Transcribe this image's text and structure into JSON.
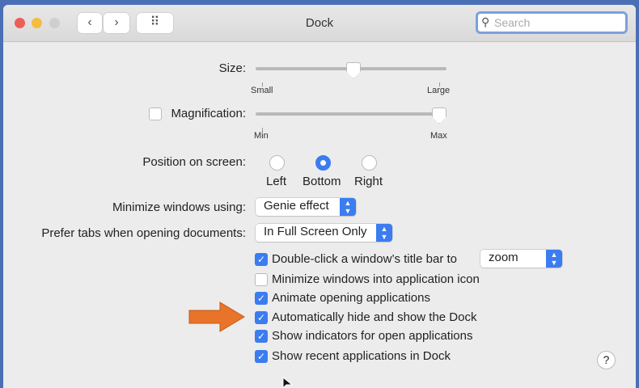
{
  "window": {
    "title": "Dock",
    "search_placeholder": "Search"
  },
  "toolbar": {
    "back": "‹",
    "forward": "›",
    "grid": "⠿"
  },
  "size": {
    "label": "Size:",
    "min": "Small",
    "max": "Large",
    "value_fraction": 0.5
  },
  "magnification": {
    "label": "Magnification:",
    "checked": false,
    "min": "Min",
    "max": "Max",
    "value_fraction": 1.0
  },
  "position": {
    "label": "Position on screen:",
    "options": [
      "Left",
      "Bottom",
      "Right"
    ],
    "selected": "Bottom"
  },
  "minimize": {
    "label": "Minimize windows using:",
    "value": "Genie effect"
  },
  "prefer_tabs": {
    "label": "Prefer tabs when opening documents:",
    "value": "In Full Screen Only"
  },
  "checkboxes": [
    {
      "label": "Double-click a window’s title bar to",
      "checked": true
    },
    {
      "label": "Minimize windows into application icon",
      "checked": false
    },
    {
      "label": "Animate opening applications",
      "checked": true
    },
    {
      "label": "Automatically hide and show the Dock",
      "checked": true
    },
    {
      "label": "Show indicators for open applications",
      "checked": true
    },
    {
      "label": "Show recent applications in Dock",
      "checked": true
    }
  ],
  "double_click_action": "zoom",
  "help": "?",
  "colors": {
    "accent": "#3b7cf0",
    "arrow": "#e8742a"
  }
}
